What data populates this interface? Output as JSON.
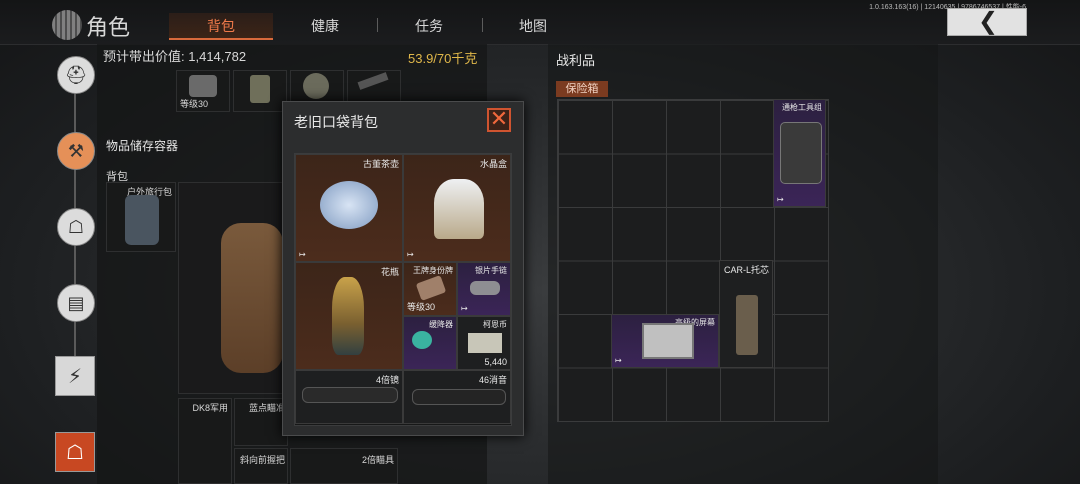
{
  "topbar": {
    "title": "角色",
    "tabs": [
      {
        "label": "背包",
        "active": true
      },
      {
        "label": "健康",
        "active": false
      },
      {
        "label": "任务",
        "active": false
      },
      {
        "label": "地图",
        "active": false
      }
    ],
    "version": "1.0.163.163(16) | 12140635 | 9786746537 | 性能-6",
    "back_icon": "chevron-left-icon"
  },
  "left_nav": [
    {
      "icon": "helmet-icon",
      "active": false
    },
    {
      "icon": "vest-icon",
      "active": true
    },
    {
      "icon": "backpack-icon",
      "active": false
    },
    {
      "icon": "box-icon",
      "active": false
    },
    {
      "icon": "lightning-icon",
      "active": false
    },
    {
      "icon": "red-backpack-icon",
      "active": false
    }
  ],
  "inventory": {
    "estimated_value_label": "预计带出价值:",
    "estimated_value": "1,414,782",
    "weight": "53.9/70千克",
    "top_row_level": "等级30",
    "storage_title": "物品储存容器",
    "backpack_label": "背包",
    "backpack_item": "户外旅行包",
    "bottom_items": [
      "DK8军用",
      "蓝点瞄准",
      "斜向前握把",
      "2倍瞄具"
    ]
  },
  "popup": {
    "title": "老旧口袋背包",
    "items": [
      {
        "name": "古董茶壶",
        "bg": "brown"
      },
      {
        "name": "水晶盒",
        "bg": "brown"
      },
      {
        "name": "花瓶",
        "bg": "brown"
      },
      {
        "name": "王牌身份牌",
        "level": "等级30",
        "bg": "brown"
      },
      {
        "name": "银片手链",
        "bg": "purple"
      },
      {
        "name": "缓降器",
        "bg": "purple"
      },
      {
        "name": "柯恩币",
        "count": "5,440",
        "bg": "grey"
      },
      {
        "name": "4倍镜",
        "bg": "grey"
      },
      {
        "name": "46消音",
        "bg": "grey"
      }
    ]
  },
  "loot": {
    "title": "战利品",
    "safebox_label": "保险箱",
    "items": [
      {
        "name": "通枪工具组",
        "bg": "purple"
      },
      {
        "name": "CAR-L托芯",
        "bg": "grey"
      },
      {
        "name": "高级的屏幕",
        "bg": "purple"
      }
    ]
  }
}
